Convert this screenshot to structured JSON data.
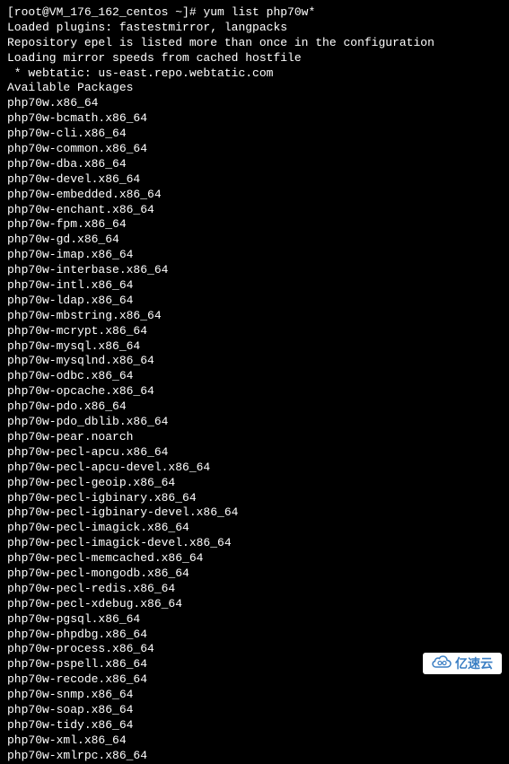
{
  "prompt": "[root@VM_176_162_centos ~]# ",
  "command": "yum list php70w*",
  "lines": [
    "Loaded plugins: fastestmirror, langpacks",
    "Repository epel is listed more than once in the configuration",
    "Loading mirror speeds from cached hostfile",
    " * webtatic: us-east.repo.webtatic.com",
    "Available Packages",
    "php70w.x86_64",
    "php70w-bcmath.x86_64",
    "php70w-cli.x86_64",
    "php70w-common.x86_64",
    "php70w-dba.x86_64",
    "php70w-devel.x86_64",
    "php70w-embedded.x86_64",
    "php70w-enchant.x86_64",
    "php70w-fpm.x86_64",
    "php70w-gd.x86_64",
    "php70w-imap.x86_64",
    "php70w-interbase.x86_64",
    "php70w-intl.x86_64",
    "php70w-ldap.x86_64",
    "php70w-mbstring.x86_64",
    "php70w-mcrypt.x86_64",
    "php70w-mysql.x86_64",
    "php70w-mysqlnd.x86_64",
    "php70w-odbc.x86_64",
    "php70w-opcache.x86_64",
    "php70w-pdo.x86_64",
    "php70w-pdo_dblib.x86_64",
    "php70w-pear.noarch",
    "php70w-pecl-apcu.x86_64",
    "php70w-pecl-apcu-devel.x86_64",
    "php70w-pecl-geoip.x86_64",
    "php70w-pecl-igbinary.x86_64",
    "php70w-pecl-igbinary-devel.x86_64",
    "php70w-pecl-imagick.x86_64",
    "php70w-pecl-imagick-devel.x86_64",
    "php70w-pecl-memcached.x86_64",
    "php70w-pecl-mongodb.x86_64",
    "php70w-pecl-redis.x86_64",
    "php70w-pecl-xdebug.x86_64",
    "php70w-pgsql.x86_64",
    "php70w-phpdbg.x86_64",
    "php70w-process.x86_64",
    "php70w-pspell.x86_64",
    "php70w-recode.x86_64",
    "php70w-snmp.x86_64",
    "php70w-soap.x86_64",
    "php70w-tidy.x86_64",
    "php70w-xml.x86_64",
    "php70w-xmlrpc.x86_64"
  ],
  "watermark": {
    "text": "亿速云"
  }
}
